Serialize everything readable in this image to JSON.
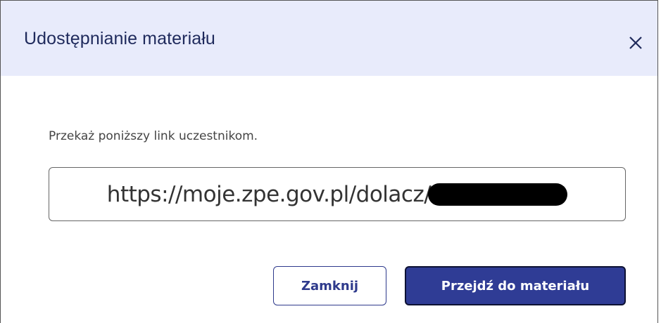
{
  "dialog": {
    "title": "Udostępnianie materiału",
    "close_icon": "close-icon",
    "instruction": "Przekaż poniższy link uczestnikom.",
    "link_text": "https://moje.zpe.gov.pl/dolacz/",
    "buttons": {
      "close_label": "Zamknij",
      "go_label": "Przejdź do materiału"
    },
    "colors": {
      "header_bg": "#e8ebfb",
      "primary": "#2f3c95",
      "title": "#1f2a5c"
    }
  }
}
